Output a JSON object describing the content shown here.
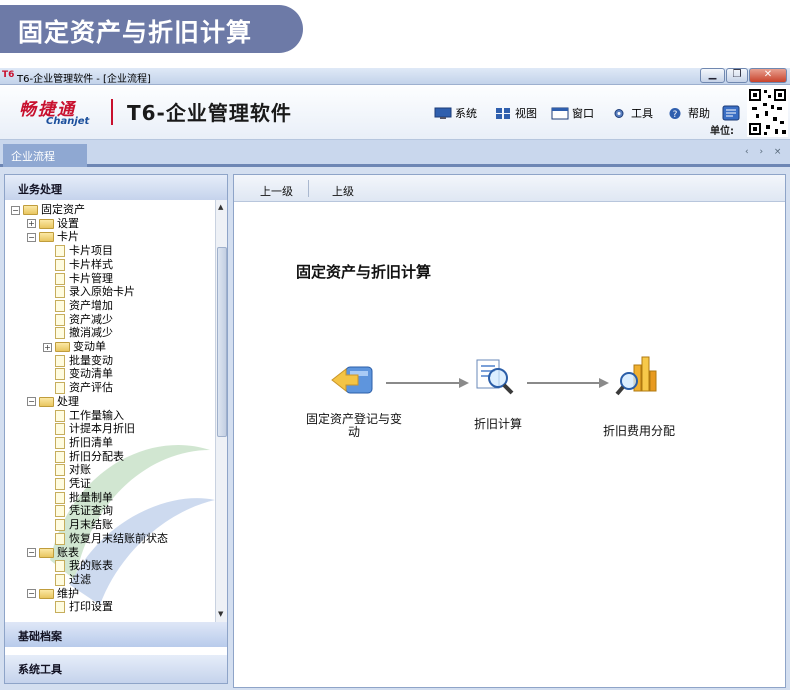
{
  "banner": {
    "title": "固定资产与折旧计算"
  },
  "window": {
    "title": "T6-企业管理软件 - [企业流程]",
    "icon": "t6-app-icon",
    "buttons": [
      "minimize",
      "restore",
      "close"
    ]
  },
  "header": {
    "brand_cn": "畅捷通",
    "brand_en": "Chanjet",
    "product": "T6-企业管理软件",
    "menu": [
      {
        "label": "系统",
        "icon": "monitor-icon"
      },
      {
        "label": "视图",
        "icon": "grid-icon"
      },
      {
        "label": "窗口",
        "icon": "window-icon"
      },
      {
        "label": "工具",
        "icon": "gear-icon"
      },
      {
        "label": "帮助",
        "icon": "help-icon"
      }
    ],
    "unit_label": "单位:",
    "qr": "qr-code"
  },
  "tabs": {
    "active": "企业流程",
    "nav": "‹ › ×"
  },
  "sidebar": {
    "section_business": "业务处理",
    "section_base": "基础档案",
    "section_tools": "系统工具",
    "tree": [
      {
        "label": "固定资产",
        "type": "folder",
        "depth": 0,
        "toggle": "−"
      },
      {
        "label": "设置",
        "type": "folder",
        "depth": 1,
        "toggle": "+"
      },
      {
        "label": "卡片",
        "type": "folder",
        "depth": 1,
        "toggle": "−"
      },
      {
        "label": "卡片项目",
        "type": "doc",
        "depth": 2
      },
      {
        "label": "卡片样式",
        "type": "doc",
        "depth": 2
      },
      {
        "label": "卡片管理",
        "type": "doc",
        "depth": 2
      },
      {
        "label": "录入原始卡片",
        "type": "doc",
        "depth": 2
      },
      {
        "label": "资产增加",
        "type": "doc",
        "depth": 2
      },
      {
        "label": "资产减少",
        "type": "doc",
        "depth": 2
      },
      {
        "label": "撤消减少",
        "type": "doc",
        "depth": 2
      },
      {
        "label": "变动单",
        "type": "folder",
        "depth": 2,
        "toggle": "+"
      },
      {
        "label": "批量变动",
        "type": "doc",
        "depth": 2
      },
      {
        "label": "变动清单",
        "type": "doc",
        "depth": 2
      },
      {
        "label": "资产评估",
        "type": "doc",
        "depth": 2
      },
      {
        "label": "处理",
        "type": "folder",
        "depth": 1,
        "toggle": "−"
      },
      {
        "label": "工作量输入",
        "type": "doc",
        "depth": 2
      },
      {
        "label": "计提本月折旧",
        "type": "doc",
        "depth": 2
      },
      {
        "label": "折旧清单",
        "type": "doc",
        "depth": 2
      },
      {
        "label": "折旧分配表",
        "type": "doc",
        "depth": 2
      },
      {
        "label": "对账",
        "type": "doc",
        "depth": 2
      },
      {
        "label": "凭证",
        "type": "doc",
        "depth": 2
      },
      {
        "label": "批量制单",
        "type": "doc",
        "depth": 2
      },
      {
        "label": "凭证查询",
        "type": "doc",
        "depth": 2
      },
      {
        "label": "月末结账",
        "type": "doc",
        "depth": 2
      },
      {
        "label": "恢复月末结账前状态",
        "type": "doc",
        "depth": 2
      },
      {
        "label": "账表",
        "type": "folder",
        "depth": 1,
        "toggle": "−"
      },
      {
        "label": "我的账表",
        "type": "doc",
        "depth": 2
      },
      {
        "label": "过滤",
        "type": "doc",
        "depth": 2
      },
      {
        "label": "维护",
        "type": "folder",
        "depth": 1,
        "toggle": "−"
      },
      {
        "label": "打印设置",
        "type": "doc",
        "depth": 2
      }
    ]
  },
  "main": {
    "toolbar": {
      "up_one": "上一级",
      "up": "上级"
    },
    "flow_title": "固定资产与折旧计算",
    "steps": [
      {
        "label": "固定资产登记与变动",
        "icon": "register-arrow-icon"
      },
      {
        "label": "折旧计算",
        "icon": "calculate-magnifier-icon"
      },
      {
        "label": "折旧费用分配",
        "icon": "chart-magnifier-icon"
      }
    ]
  }
}
